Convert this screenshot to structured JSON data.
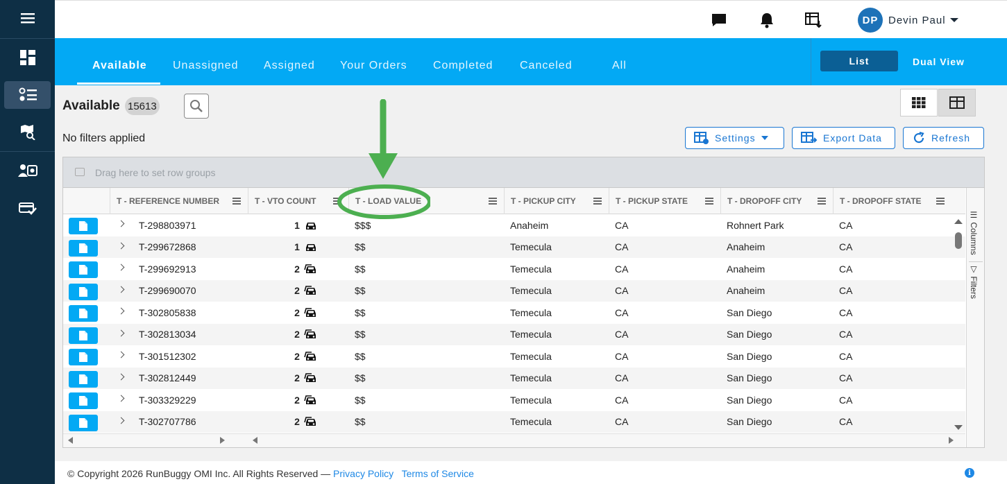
{
  "user": {
    "initials": "DP",
    "name": "Devin Paul"
  },
  "tabs": [
    {
      "label": "Available",
      "active": true
    },
    {
      "label": "Unassigned"
    },
    {
      "label": "Assigned"
    },
    {
      "label": "Your Orders"
    },
    {
      "label": "Completed"
    },
    {
      "label": "Canceled"
    },
    {
      "label": "All"
    }
  ],
  "view_modes": {
    "list": "List",
    "dual": "Dual View"
  },
  "page": {
    "title": "Available",
    "count": "15613",
    "filter_status": "No filters applied"
  },
  "actions": {
    "settings": "Settings",
    "export": "Export Data",
    "refresh": "Refresh"
  },
  "grid": {
    "row_group_hint": "Drag here to set row groups",
    "columns": [
      "T - REFERENCE NUMBER",
      "T - VTO COUNT",
      "T - LOAD VALUE",
      "T - PICKUP CITY",
      "T - PICKUP STATE",
      "T - DROPOFF CITY",
      "T - DROPOFF STATE"
    ],
    "rows": [
      {
        "ref": "T-298803971",
        "vto": "1",
        "value": "$$$",
        "pickup_city": "Anaheim",
        "pickup_state": "CA",
        "dropoff_city": "Rohnert Park",
        "dropoff_state": "CA"
      },
      {
        "ref": "T-299672868",
        "vto": "1",
        "value": "$$",
        "pickup_city": "Temecula",
        "pickup_state": "CA",
        "dropoff_city": "Anaheim",
        "dropoff_state": "CA"
      },
      {
        "ref": "T-299692913",
        "vto": "2",
        "value": "$$",
        "pickup_city": "Temecula",
        "pickup_state": "CA",
        "dropoff_city": "Anaheim",
        "dropoff_state": "CA"
      },
      {
        "ref": "T-299690070",
        "vto": "2",
        "value": "$$",
        "pickup_city": "Temecula",
        "pickup_state": "CA",
        "dropoff_city": "Anaheim",
        "dropoff_state": "CA"
      },
      {
        "ref": "T-302805838",
        "vto": "2",
        "value": "$$",
        "pickup_city": "Temecula",
        "pickup_state": "CA",
        "dropoff_city": "San Diego",
        "dropoff_state": "CA"
      },
      {
        "ref": "T-302813034",
        "vto": "2",
        "value": "$$",
        "pickup_city": "Temecula",
        "pickup_state": "CA",
        "dropoff_city": "San Diego",
        "dropoff_state": "CA"
      },
      {
        "ref": "T-301512302",
        "vto": "2",
        "value": "$$",
        "pickup_city": "Temecula",
        "pickup_state": "CA",
        "dropoff_city": "San Diego",
        "dropoff_state": "CA"
      },
      {
        "ref": "T-302812449",
        "vto": "2",
        "value": "$$",
        "pickup_city": "Temecula",
        "pickup_state": "CA",
        "dropoff_city": "San Diego",
        "dropoff_state": "CA"
      },
      {
        "ref": "T-303329229",
        "vto": "2",
        "value": "$$",
        "pickup_city": "Temecula",
        "pickup_state": "CA",
        "dropoff_city": "San Diego",
        "dropoff_state": "CA"
      },
      {
        "ref": "T-302707786",
        "vto": "2",
        "value": "$$",
        "pickup_city": "Temecula",
        "pickup_state": "CA",
        "dropoff_city": "San Diego",
        "dropoff_state": "CA"
      }
    ],
    "side_tabs": {
      "columns": "Columns",
      "filters": "Filters"
    }
  },
  "footer": {
    "copyright": "© Copyright 2026 RunBuggy OMI Inc. All Rights Reserved —",
    "privacy": "Privacy Policy",
    "terms": "Terms of Service"
  },
  "colors": {
    "brand_blue": "#03a9f4",
    "sidebar": "#0e2f45",
    "annotation_green": "#4caf50"
  }
}
